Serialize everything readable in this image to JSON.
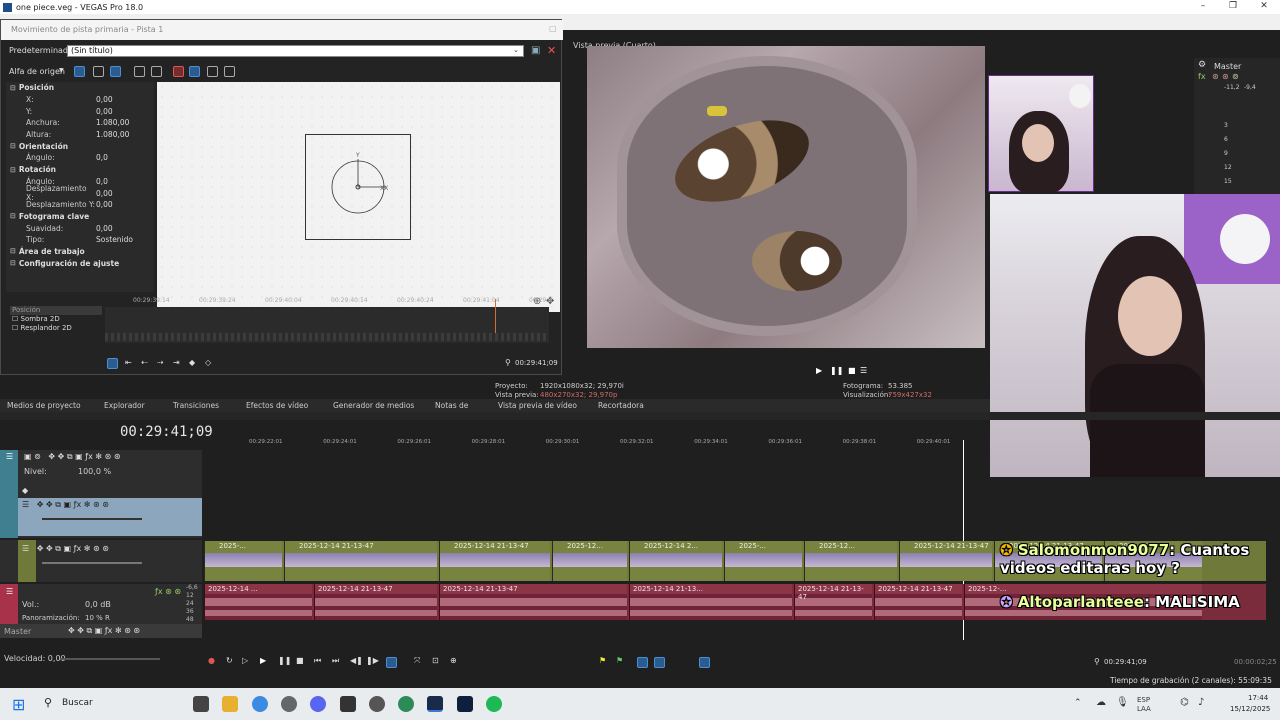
{
  "window": {
    "title": "one piece.veg - VEGAS Pro 18.0"
  },
  "dialog": {
    "title": "Movimiento de pista primaria - Pista 1",
    "preset_label": "Predeterminado:",
    "preset_value": "(Sin título)",
    "origin_label": "Alfa de origen"
  },
  "properties": [
    {
      "kind": "head",
      "label": "Posición"
    },
    {
      "kind": "item",
      "key": "X:",
      "value": "0,00"
    },
    {
      "kind": "item",
      "key": "Y:",
      "value": "0,00"
    },
    {
      "kind": "item",
      "key": "Anchura:",
      "value": "1.080,00"
    },
    {
      "kind": "item",
      "key": "Altura:",
      "value": "1.080,00"
    },
    {
      "kind": "head",
      "label": "Orientación"
    },
    {
      "kind": "item",
      "key": "Ángulo:",
      "value": "0,0"
    },
    {
      "kind": "head",
      "label": "Rotación"
    },
    {
      "kind": "item",
      "key": "Ángulo:",
      "value": "0,0"
    },
    {
      "kind": "item",
      "key": "Desplazamiento X:",
      "value": "0,00"
    },
    {
      "kind": "item",
      "key": "Desplazamiento Y:",
      "value": "0,00"
    },
    {
      "kind": "head",
      "label": "Fotograma clave"
    },
    {
      "kind": "item",
      "key": "Suavidad:",
      "value": "0,00"
    },
    {
      "kind": "item",
      "key": "Tipo:",
      "value": "Sostenido"
    },
    {
      "kind": "head",
      "label": "Área de trabajo"
    },
    {
      "kind": "head",
      "label": "Configuración de ajuste"
    }
  ],
  "keyframe": {
    "ruler": [
      "00:29:39:14",
      "00:29:39:24",
      "00:29:40:04",
      "00:29:40:14",
      "00:29:40:24",
      "00:29:41:04",
      "00:29:4"
    ],
    "tracks": [
      "Posición",
      "Sombra 2D",
      "Resplandor 2D"
    ],
    "timecode": "00:29:41;09"
  },
  "preview": {
    "header": "Vista previa (Cuarto)",
    "project_label": "Proyecto:",
    "project_value": "1920x1080x32; 29,970i",
    "preview_label": "Vista previa:",
    "preview_value": "480x270x32; 29,970p",
    "frame_label": "Fotograma:",
    "frame_value": "53.385",
    "display_label": "Visualización:",
    "display_value": "759x427x32"
  },
  "master": {
    "label": "Master",
    "levels": [
      "-11,2",
      "-9,4"
    ],
    "scale": [
      "3",
      "6",
      "9",
      "12",
      "15"
    ]
  },
  "tabs": [
    "Medios de proyecto",
    "Explorador",
    "Transiciones",
    "Efectos de vídeo",
    "Generador de medios",
    "Notas de",
    "Vista previa de vídeo",
    "Recortadora"
  ],
  "timeline": {
    "timecode": "00:29:41;09",
    "ruler": [
      "00:29:22:01",
      "00:29:24:01",
      "00:29:26:01",
      "00:29:28:01",
      "00:29:30:01",
      "00:29:32:01",
      "00:29:34:01",
      "00:29:36:01",
      "00:29:38:01",
      "00:29:40:01"
    ],
    "level_label": "Nivel:",
    "level_value": "100,0 %",
    "vol_label": "Vol.:",
    "vol_value": "0,0 dB",
    "pan_label": "Panoramización:",
    "pan_value": "10 % R",
    "master_label": "Master",
    "speed_label": "Velocidad: 0,00",
    "clip_names": [
      "2025-...",
      "2025-12-14 21-13-47",
      "2025-12-14 21-13-47",
      "2025-12...",
      "2025-12-14 2...",
      "2025-...",
      "2025-12...",
      "2025-12-14 21-13-47",
      "2025-12-14 21-13-47",
      "2025-12"
    ],
    "audio_clip_names": [
      "2025-12-14 ...",
      "2025-12-14 21-13-47",
      "2025-12-14 21-13-47",
      "2025-12-14 21-13...",
      "2025-12-14 21-13-47",
      "2025-12-14 21-13-47",
      "2025-12-..."
    ],
    "db_scale": [
      "-6,6",
      "12",
      "24",
      "36",
      "48"
    ],
    "end_timecode": "00:29:41;09",
    "end_duration": "00:00:02;25",
    "record_time": "Tiempo de grabación (2 canales): 55:09:35"
  },
  "chat": [
    {
      "user": "Salomonmon9077",
      "text": ": Cuantos videos editaras hoy ?"
    },
    {
      "user": "Altoparlanteee",
      "text": ": MALISIMA"
    }
  ],
  "taskbar": {
    "search_placeholder": "Buscar",
    "lang": "ESP",
    "layout": "LAA",
    "time": "17:44",
    "date": "15/12/2025"
  },
  "colors": {
    "video_track": "#6f7a3a",
    "audio_track": "#7a2c3d",
    "accent": "#2f6fb0"
  }
}
